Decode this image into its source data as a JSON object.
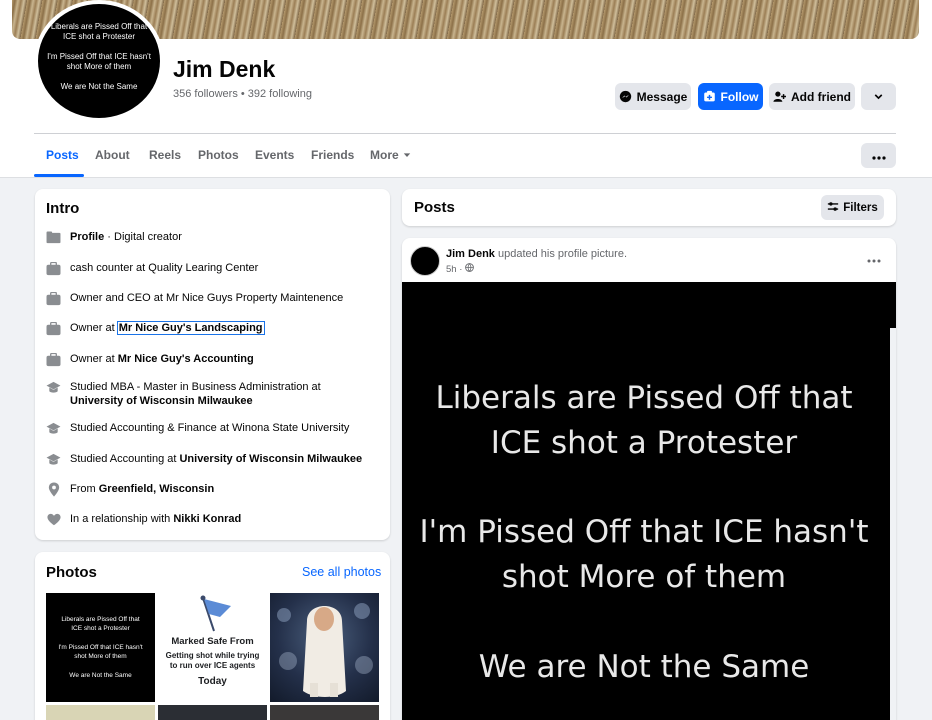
{
  "profile": {
    "name": "Jim Denk",
    "stats": "356 followers • 392 following",
    "avatar_lines": [
      "Liberals are Pissed Off that",
      "ICE shot a Protester",
      "I'm Pissed Off that ICE hasn't",
      "shot More of them",
      "We are Not the Same"
    ]
  },
  "actions": {
    "message": "Message",
    "follow": "Follow",
    "add_friend": "Add friend"
  },
  "tabs": [
    {
      "label": "Posts",
      "active": true
    },
    {
      "label": "About"
    },
    {
      "label": "Reels"
    },
    {
      "label": "Photos"
    },
    {
      "label": "Events"
    },
    {
      "label": "Friends"
    },
    {
      "label": "More"
    }
  ],
  "intro": {
    "title": "Intro",
    "items": [
      {
        "icon": "profile-icon",
        "bold": "Profile",
        "rest": " · Digital creator"
      },
      {
        "icon": "briefcase-icon",
        "text": "cash counter at Quality Learing Center"
      },
      {
        "icon": "briefcase-icon",
        "text": "Owner and CEO at Mr Nice Guys Property Maintenence"
      },
      {
        "icon": "briefcase-icon",
        "pre": "Owner at ",
        "link": "Mr Nice Guy's Landscaping"
      },
      {
        "icon": "briefcase-icon",
        "pre": "Owner at ",
        "link": "Mr Nice Guy's Accounting"
      },
      {
        "icon": "graduation-cap-icon",
        "pre": "Studied MBA - Master in Business Administration at ",
        "link": "University of Wisconsin Milwaukee"
      },
      {
        "icon": "graduation-cap-icon",
        "text": "Studied Accounting & Finance at Winona State University"
      },
      {
        "icon": "graduation-cap-icon",
        "pre": "Studied Accounting at ",
        "link": "University of Wisconsin Milwaukee"
      },
      {
        "icon": "location-pin-icon",
        "pre": "From ",
        "link": "Greenfield, Wisconsin"
      },
      {
        "icon": "heart-icon",
        "pre": "In a relationship with ",
        "link": "Nikki Konrad"
      }
    ]
  },
  "photos": {
    "title": "Photos",
    "see_all": "See all photos",
    "photo1_lines": [
      "Liberals are Pissed Off that",
      "ICE shot a Protester",
      "I'm Pissed Off that ICE hasn't",
      "shot More of them",
      "We are Not the Same"
    ],
    "photo2": {
      "line1": "Marked Safe From",
      "line2a": "Getting shot while trying",
      "line2b": "to run over ICE agents",
      "line3": "Today"
    }
  },
  "posts": {
    "title": "Posts",
    "filters": "Filters",
    "post": {
      "author": "Jim Denk",
      "action": " updated his profile picture.",
      "time": "5h ·",
      "image_lines": [
        "Liberals are Pissed Off that",
        "ICE shot a Protester",
        "I'm Pissed Off that ICE hasn't",
        "shot More of them",
        "We are Not the Same"
      ]
    }
  },
  "colors": {
    "accent": "#0866ff",
    "page_bg": "#f0f2f5",
    "button_gray": "#e4e6eb"
  }
}
